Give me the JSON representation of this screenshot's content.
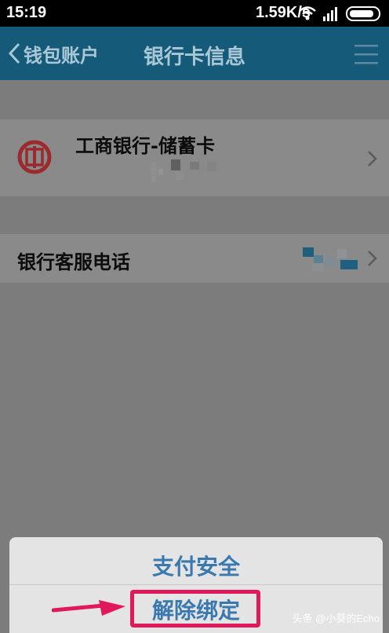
{
  "status_bar": {
    "time": "15:19",
    "network_speed": "1.59K/s",
    "icons": [
      "wifi-icon",
      "signal-icon",
      "battery-icon"
    ]
  },
  "header": {
    "back_label": "钱包账户",
    "title": "银行卡信息",
    "menu_icon": "menu-icon"
  },
  "bank_card": {
    "name": "工商银行-储蓄卡",
    "logo_icon": "icbc-logo",
    "number": ""
  },
  "service_phone": {
    "label": "银行客服电话",
    "number": ""
  },
  "action_sheet": {
    "pay_security": "支付安全",
    "unbind": "解除绑定"
  },
  "annotation": {
    "highlight_color": "#e0195d"
  },
  "watermark": "头条 @小葵的Echo",
  "colors": {
    "header_bg": "#165a7a",
    "action_text": "#3a79b0",
    "bank_red": "#c0262d"
  }
}
